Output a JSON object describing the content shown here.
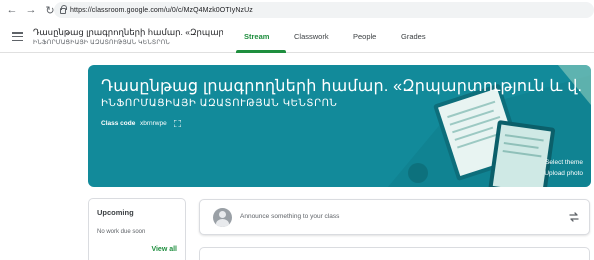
{
  "browser": {
    "url": "https://classroom.google.com/u/0/c/MzQ4Mzk0OTIyNzUz"
  },
  "header": {
    "class_title": "Դասընթաց լրագրողների համար. «Զրպարտություն...",
    "class_subtitle": "ԻՆՖՈՐՄԱՑԻԱՅԻ ԱԶԱՏՈՒԹՅԱՆ ԿԵՆՏՐՈՆ",
    "tabs": [
      {
        "label": "Stream",
        "active": true
      },
      {
        "label": "Classwork",
        "active": false
      },
      {
        "label": "People",
        "active": false
      },
      {
        "label": "Grades",
        "active": false
      }
    ]
  },
  "banner": {
    "title": "Դասընթաց լրագրողների համար. «Զրպարտություն և վ...",
    "subtitle": "ԻՆՖՈՐՄԱՑԻԱՅԻ ԱԶԱՏՈՒԹՅԱՆ ԿԵՆՏՐՈՆ",
    "class_code_label": "Class code",
    "class_code_value": "xbrnrwpe",
    "select_theme": "Select theme",
    "upload_photo": "Upload photo",
    "color": "#128a9a"
  },
  "upcoming": {
    "title": "Upcoming",
    "empty_text": "No work due soon",
    "view_all": "View all"
  },
  "announce": {
    "placeholder": "Announce something to your class"
  },
  "icons": [
    "back-icon",
    "forward-icon",
    "reload-icon",
    "lock-icon",
    "menu-icon",
    "fullscreen-icon",
    "avatar",
    "repost-icon"
  ],
  "colors": {
    "accent": "#1e8e3e",
    "banner": "#128a9a"
  }
}
